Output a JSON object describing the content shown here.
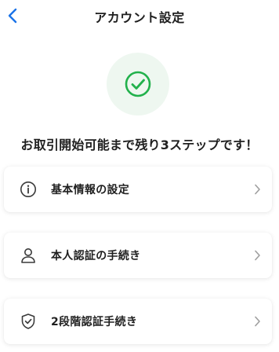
{
  "header": {
    "title": "アカウント設定",
    "back_icon": "chevron-left-icon",
    "back_color": "#1a73e8"
  },
  "status": {
    "icon": "check-circle-icon",
    "icon_color": "#22b14c",
    "circle_bg": "#eef7f0"
  },
  "message": "お取引開始可能まで残り3ステップです！",
  "steps": [
    {
      "label": "基本情報の設定",
      "icon": "info-icon"
    },
    {
      "label": "本人認証の手続き",
      "icon": "person-icon"
    },
    {
      "label": "2段階認証手続き",
      "icon": "shield-check-icon"
    }
  ]
}
